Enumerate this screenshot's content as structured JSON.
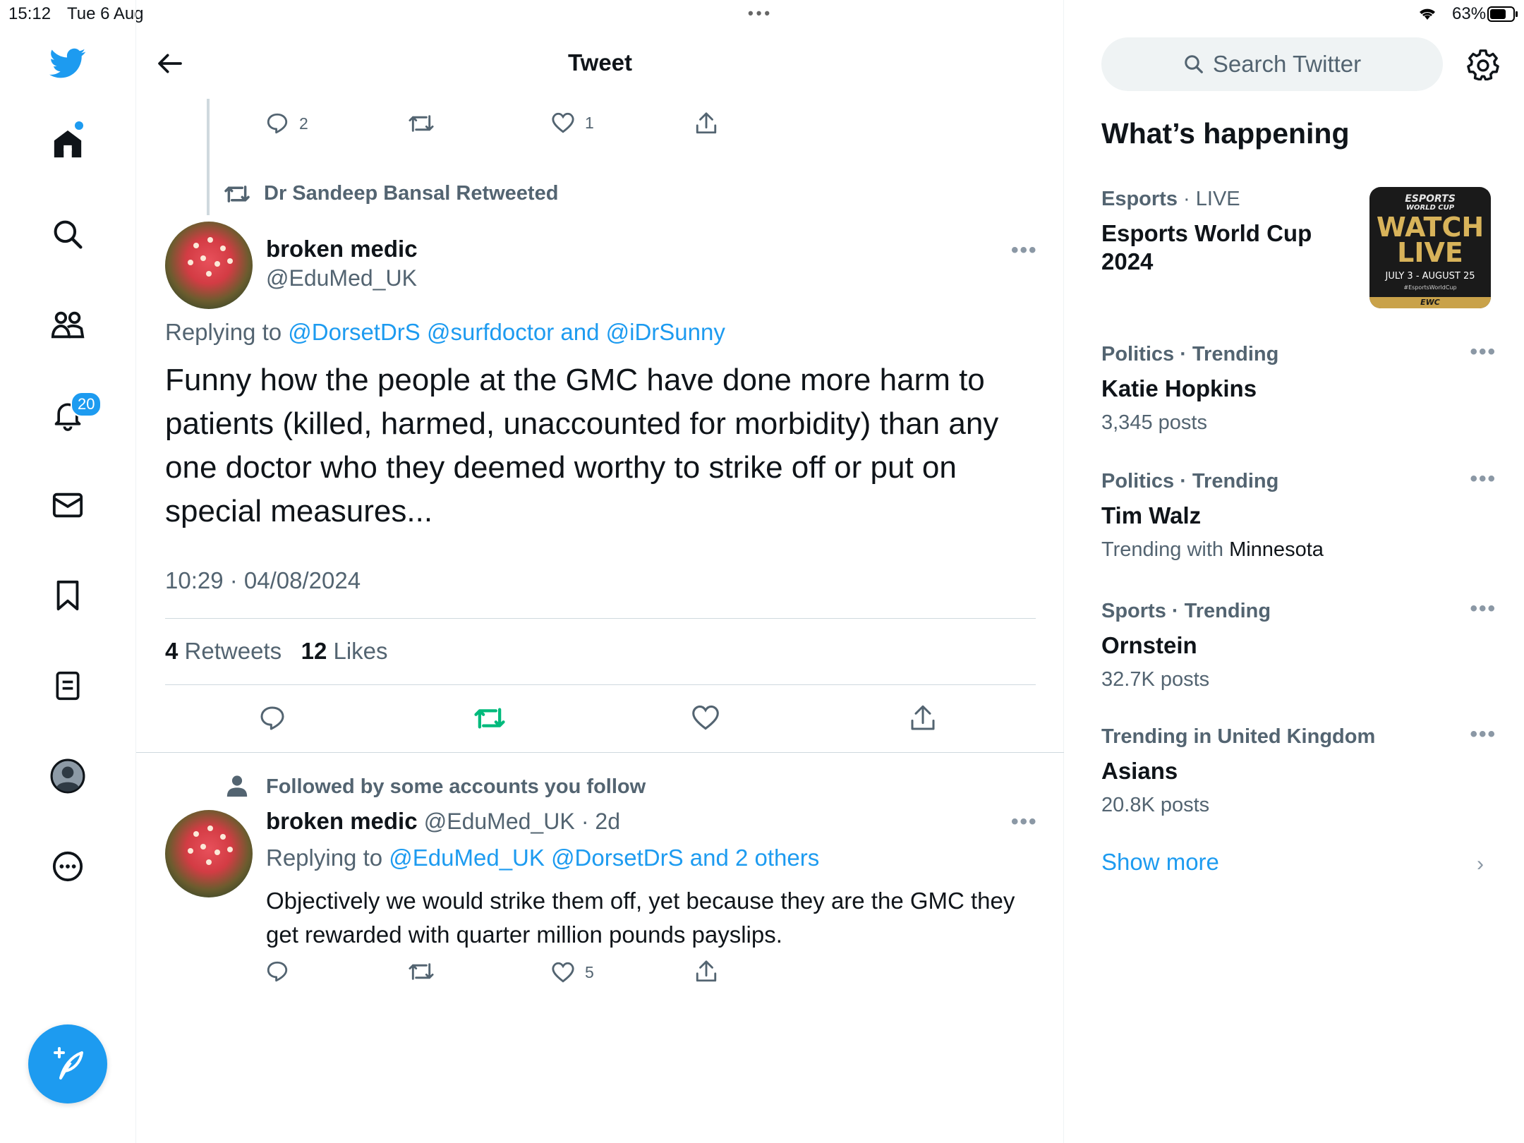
{
  "status_bar": {
    "time": "15:12",
    "date": "Tue 6 Aug",
    "battery": "63%"
  },
  "nav": {
    "notifications_badge": "20"
  },
  "header": {
    "title": "Tweet"
  },
  "prev_tweet": {
    "replies": "2",
    "likes": "1"
  },
  "retweet_banner": "Dr Sandeep Bansal Retweeted",
  "main_tweet": {
    "name": "broken medic",
    "handle": "@EduMed_UK",
    "replying_label": "Replying to",
    "replying_to_1": "@DorsetDrS",
    "replying_to_2": "@surfdoctor",
    "replying_and": "and",
    "replying_to_3": "@iDrSunny",
    "text": "Funny how the people at the GMC have done more harm to patients (killed, harmed, unaccounted for morbidity) than any one doctor who they deemed worthy to strike off or put on special measures...",
    "timestamp": "10:29 · 04/08/2024",
    "retweets_count": "4",
    "retweets_label": "Retweets",
    "likes_count": "12",
    "likes_label": "Likes"
  },
  "reply": {
    "context": "Followed by some accounts you follow",
    "name": "broken medic",
    "handle": "@EduMed_UK",
    "age": "· 2d",
    "replying_label": "Replying to",
    "replying_to_1": "@EduMed_UK",
    "replying_to_2": "@DorsetDrS",
    "replying_and_others": "and 2 others",
    "text": "Objectively we would strike them off, yet because they are the GMC they get rewarded with quarter million pounds payslips.",
    "likes": "5"
  },
  "sidebar": {
    "search_placeholder": "Search Twitter",
    "heading": "What’s happening",
    "trends": [
      {
        "category": "Esports",
        "live": "· LIVE",
        "title": "Esports World Cup 2024"
      },
      {
        "category": "Politics · Trending",
        "title": "Katie Hopkins",
        "sub": "3,345 posts"
      },
      {
        "category": "Politics · Trending",
        "title": "Tim Walz",
        "sub_prefix": "Trending with",
        "sub_bold": "Minnesota"
      },
      {
        "category": "Sports · Trending",
        "title": "Ornstein",
        "sub": "32.7K posts"
      },
      {
        "category": "Trending in United Kingdom",
        "title": "Asians",
        "sub": "20.8K posts"
      }
    ],
    "promo_image": {
      "line1": "ESPORTS",
      "line2": "WORLD CUP",
      "line3": "WATCH",
      "line4": "LIVE",
      "dates": "JULY 3 - AUGUST 25",
      "hashtag": "#EsportsWorldCup",
      "ticker": "EWC"
    },
    "show_more": "Show more"
  },
  "colors": {
    "accent": "#1d9bf0",
    "retweet_green": "#00ba7c",
    "secondary_text": "#536471"
  }
}
